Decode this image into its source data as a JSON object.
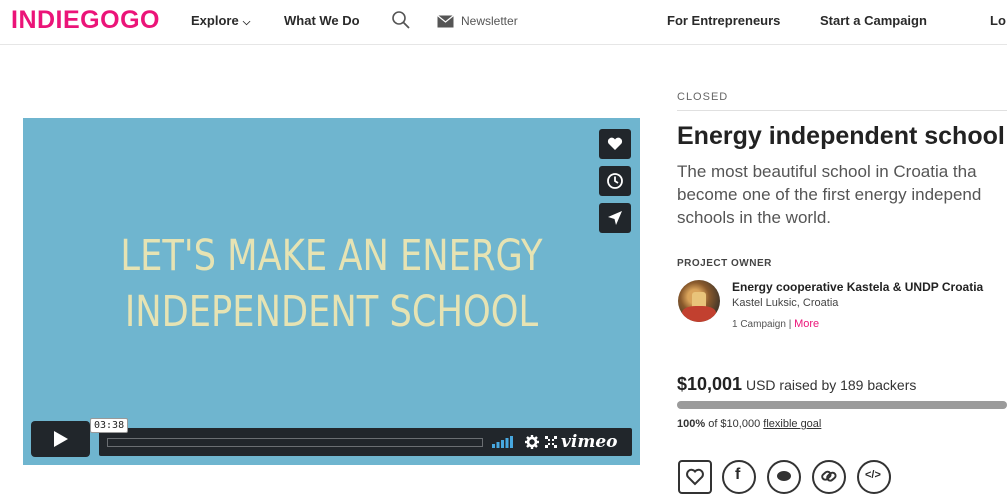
{
  "header": {
    "logo": "INDIEGOGO",
    "explore": "Explore",
    "what_we_do": "What We Do",
    "newsletter": "Newsletter",
    "for_entrepreneurs": "For Entrepreneurs",
    "start_campaign": "Start a Campaign",
    "login": "Lo"
  },
  "video": {
    "line1": "LET'S MAKE AN ENERGY",
    "line2": "INDEPENDENT SCHOOL",
    "time": "03:38",
    "brand": "vimeo",
    "side_buttons": [
      "heart-icon",
      "clock-icon",
      "send-icon"
    ]
  },
  "campaign": {
    "status": "CLOSED",
    "title": "Energy independent school",
    "tagline_1": "The most beautiful school in Croatia tha",
    "tagline_2": "become one of the first energy independ",
    "tagline_3": "schools in the world."
  },
  "owner": {
    "label": "PROJECT OWNER",
    "name": "Energy cooperative Kastela & UNDP Croatia",
    "location": "Kastel Luksic, Croatia",
    "campaigns": "1 Campaign",
    "separator": "|",
    "more": "More"
  },
  "funding": {
    "amount": "$10,001",
    "raised_text": "USD raised by 189 backers",
    "percent_label": "100%",
    "goal_text": "of $10,000",
    "goal_type": "flexible goal",
    "progress_fraction": 1.0
  },
  "colors": {
    "brand": "#eb1478",
    "video_bg": "#6fb5cf",
    "video_text": "#e6e3b3",
    "control_dark": "#21262b"
  }
}
